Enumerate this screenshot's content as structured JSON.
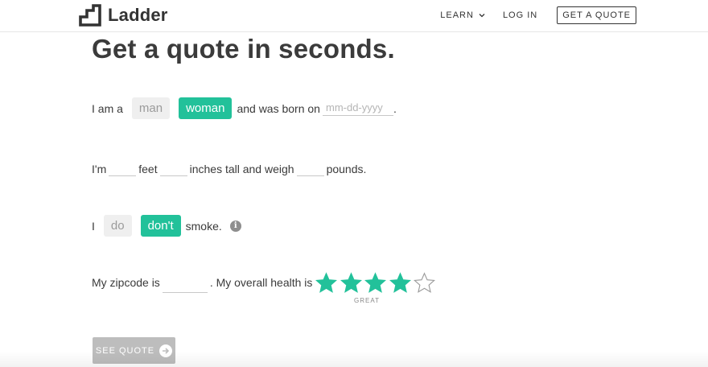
{
  "header": {
    "brand": "Ladder",
    "nav": {
      "learn": "LEARN",
      "login": "LOG IN",
      "cta": "GET A QUOTE"
    }
  },
  "title": "Get a quote in seconds.",
  "gender_row": {
    "prefix": "I am a",
    "option_man": "man",
    "option_woman": "woman",
    "selected": "woman",
    "middle": "and was born on",
    "date_placeholder": "mm-dd-yyyy",
    "suffix": "."
  },
  "size_row": {
    "prefix": "I'm",
    "feet": "feet",
    "inches": "inches tall and weigh",
    "pounds": "pounds."
  },
  "smoke_row": {
    "prefix": "I",
    "option_do": "do",
    "option_dont": "don't",
    "selected": "don't",
    "suffix": "smoke.",
    "info_glyph": "i"
  },
  "health_row": {
    "zip_label": "My zipcode is",
    "health_label": ". My overall health is",
    "rating": 4,
    "rating_max": 5,
    "rating_label": "GREAT"
  },
  "submit": {
    "label": "SEE QUOTE",
    "icon": "arrow-right-circle-icon"
  },
  "colors": {
    "accent": "#22c19a",
    "button_disabled": "#bdbdbd",
    "option_off_bg": "#efefef"
  }
}
